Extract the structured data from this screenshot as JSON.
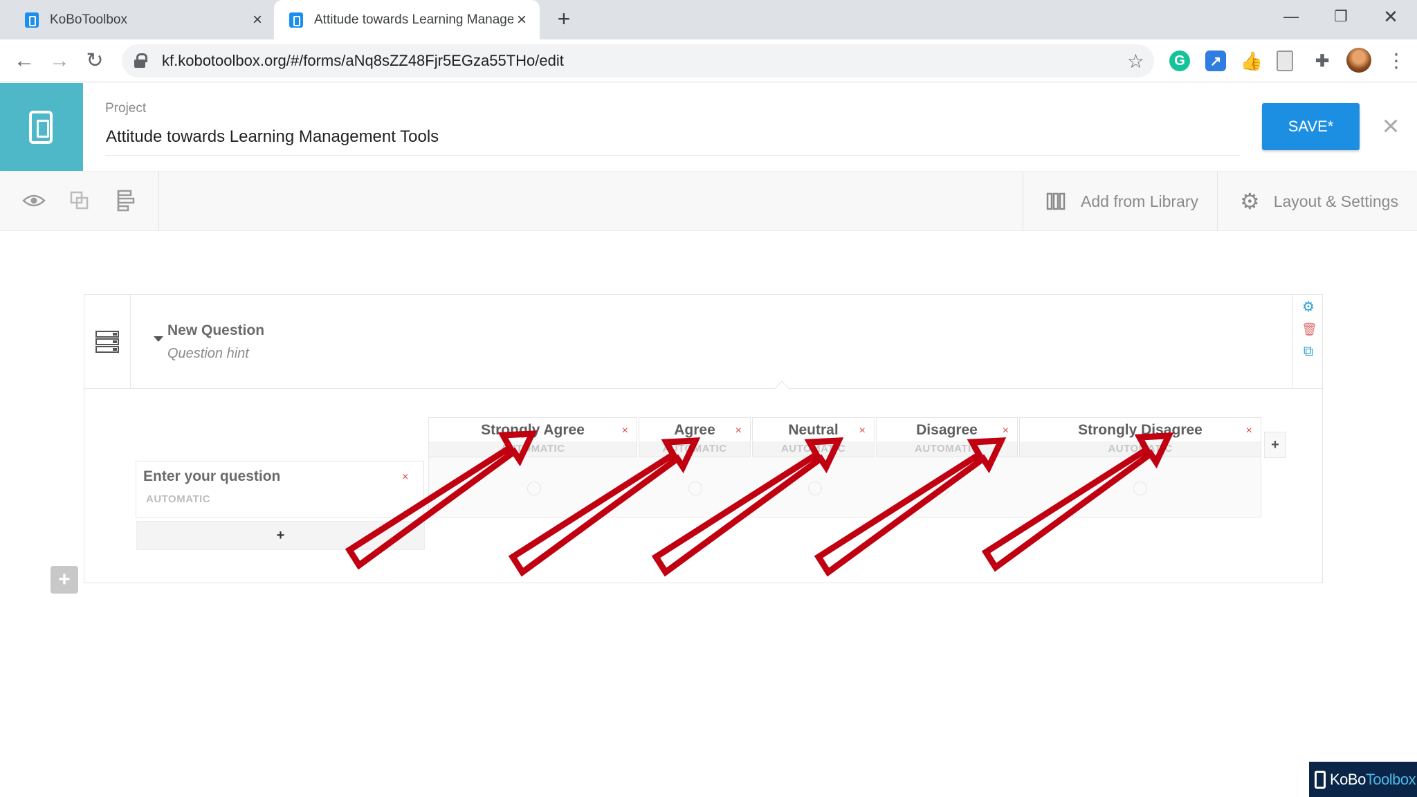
{
  "browser": {
    "tabs": [
      {
        "title": "KoBoToolbox",
        "active": false
      },
      {
        "title": "Attitude towards Learning Management Tools - KoBoToolbox",
        "active": true
      }
    ],
    "url": "kf.kobotoolbox.org/#/forms/aNq8sZZ48Fjr5EGza55THo/edit",
    "extensions": [
      "grammarly-icon",
      "edit-link-icon",
      "thumb-icon",
      "page-icon",
      "puzzle-icon"
    ]
  },
  "header": {
    "project_label": "Project",
    "project_name": "Attitude towards Learning Management Tools",
    "save_label": "SAVE*"
  },
  "form_toolbar": {
    "add_from_library": "Add from Library",
    "layout_settings": "Layout & Settings"
  },
  "question": {
    "label": "New Question",
    "hint": "Question hint",
    "options": [
      {
        "label": "Strongly Agree",
        "value": "AUTOMATIC"
      },
      {
        "label": "Agree",
        "value": "AUTOMATIC"
      },
      {
        "label": "Neutral",
        "value": "AUTOMATIC"
      },
      {
        "label": "Disagree",
        "value": "AUTOMATIC"
      },
      {
        "label": "Strongly Disagree",
        "value": "AUTOMATIC"
      }
    ],
    "rows": [
      {
        "label": "Enter your question",
        "value": "AUTOMATIC"
      }
    ],
    "add_row": "+",
    "add_option": "+"
  },
  "watermark": {
    "brand_a": "KoBo",
    "brand_b": "Toolbox"
  },
  "colors": {
    "brand": "#4eb8c8",
    "save": "#1d8fe3",
    "arrow": "#c00010"
  }
}
